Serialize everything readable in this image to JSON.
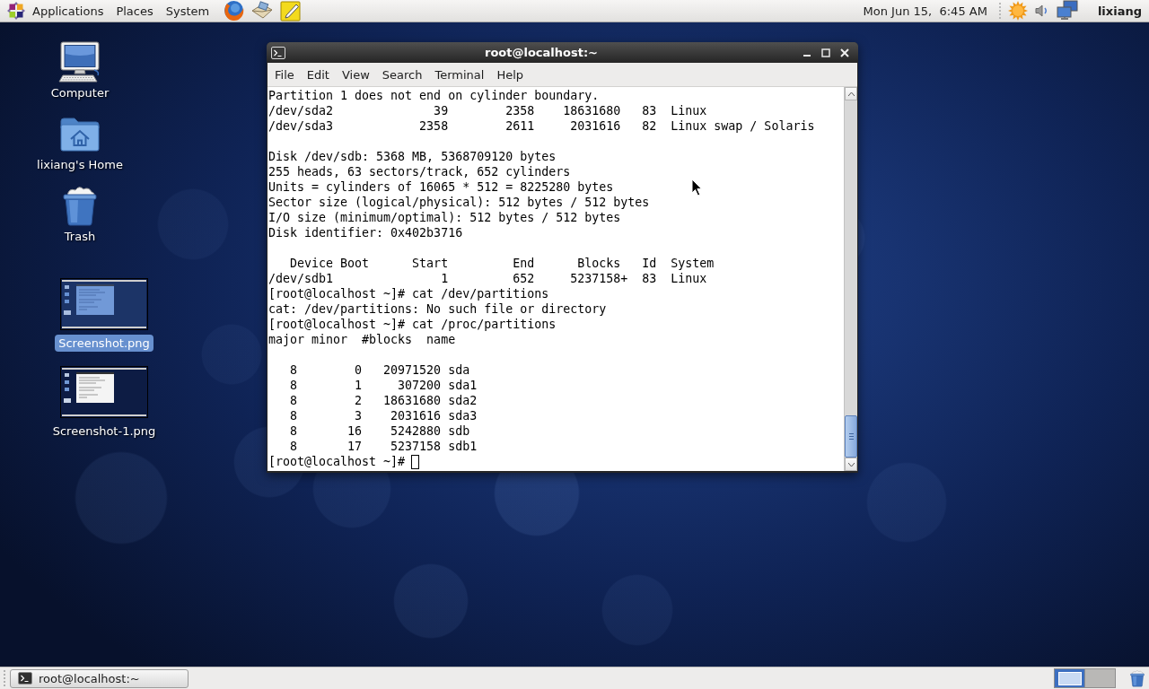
{
  "top_panel": {
    "menus": [
      "Applications",
      "Places",
      "System"
    ],
    "clock": "Mon Jun 15,  6:45 AM",
    "user": "lixiang"
  },
  "desktop": {
    "icons": [
      {
        "label": "Computer",
        "kind": "computer",
        "selected": false
      },
      {
        "label": "lixiang's Home",
        "kind": "home",
        "selected": false
      },
      {
        "label": "Trash",
        "kind": "trash",
        "selected": false
      },
      {
        "label": "Screenshot.png",
        "kind": "image",
        "selected": true
      },
      {
        "label": "Screenshot-1.png",
        "kind": "image",
        "selected": false
      }
    ]
  },
  "terminal": {
    "title": "root@localhost:~",
    "menu": [
      "File",
      "Edit",
      "View",
      "Search",
      "Terminal",
      "Help"
    ],
    "output_blocks": [
      [
        "Partition 1 does not end on cylinder boundary.",
        "/dev/sda2              39        2358    18631680   83  Linux",
        "/dev/sda3            2358        2611     2031616   82  Linux swap / Solaris"
      ],
      [
        "Disk /dev/sdb: 5368 MB, 5368709120 bytes",
        "255 heads, 63 sectors/track, 652 cylinders",
        "Units = cylinders of 16065 * 512 = 8225280 bytes",
        "Sector size (logical/physical): 512 bytes / 512 bytes",
        "I/O size (minimum/optimal): 512 bytes / 512 bytes",
        "Disk identifier: 0x402b3716"
      ],
      [
        "   Device Boot      Start         End      Blocks   Id  System",
        "/dev/sdb1               1         652     5237158+  83  Linux",
        "[root@localhost ~]# cat /dev/partitions",
        "cat: /dev/partitions: No such file or directory",
        "[root@localhost ~]# cat /proc/partitions",
        "major minor  #blocks  name"
      ],
      [
        "   8        0   20971520 sda",
        "   8        1     307200 sda1",
        "   8        2   18631680 sda2",
        "   8        3    2031616 sda3",
        "   8       16    5242880 sdb",
        "   8       17    5237158 sdb1"
      ]
    ],
    "prompt": "[root@localhost ~]#"
  },
  "bottom_panel": {
    "tasks": [
      {
        "label": "root@localhost:~"
      }
    ],
    "workspaces": [
      {
        "selected": true,
        "has_window": true
      },
      {
        "selected": false,
        "has_window": false
      }
    ]
  }
}
